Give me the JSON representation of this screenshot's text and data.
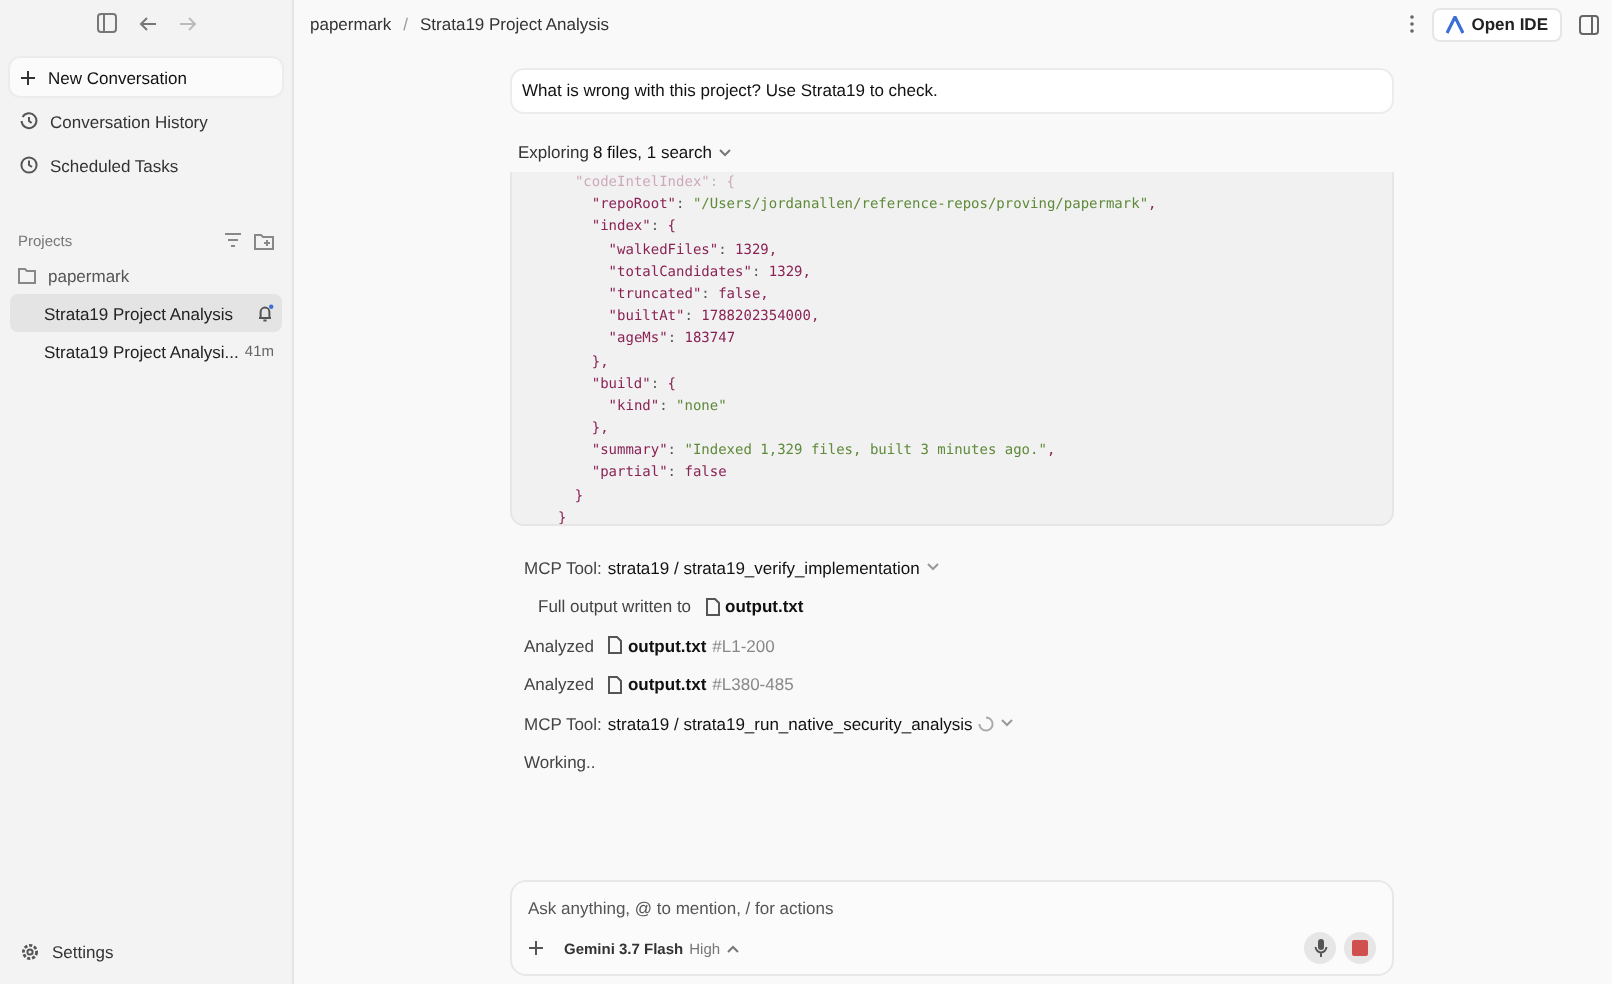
{
  "sidebar": {
    "nav": [
      {
        "kind": "new",
        "label": "New Conversation"
      },
      {
        "kind": "history",
        "label": "Conversation History"
      },
      {
        "kind": "scheduled",
        "label": "Scheduled Tasks"
      }
    ],
    "projects_label": "Projects",
    "project": {
      "name": "papermark",
      "conversations": [
        {
          "title": "Strata19 Project Analysis",
          "selected": true
        },
        {
          "title": "Strata19 Project Analysi...",
          "time": "41m",
          "selected": false
        }
      ]
    },
    "settings": "Settings"
  },
  "breadcrumb": [
    "papermark",
    "Strata19 Project Analysis"
  ],
  "breadcrumb_separator": "/",
  "open_ide": "Open IDE",
  "user_message": "What is wrong with this project? Use Strata19 to check.",
  "exploring": {
    "prefix": "Exploring",
    "summary": "8 files, 1 search"
  },
  "code_lines": [
    {
      "text": "  \"codeIntelIndex\": {",
      "faded": true
    },
    {
      "text": "    \"repoRoot\": \"/Users/jordanallen/reference-repos/proving/papermark\",",
      "faded": false
    },
    {
      "text": "    \"index\": {",
      "faded": false
    },
    {
      "text": "      \"walkedFiles\": 1329,",
      "faded": false
    },
    {
      "text": "      \"totalCandidates\": 1329,",
      "faded": false
    },
    {
      "text": "      \"truncated\": false,",
      "faded": false
    },
    {
      "text": "      \"builtAt\": 1788202354000,",
      "faded": false
    },
    {
      "text": "      \"ageMs\": 183747",
      "faded": false
    },
    {
      "text": "    },",
      "faded": false
    },
    {
      "text": "    \"build\": {",
      "faded": false
    },
    {
      "text": "      \"kind\": \"none\"",
      "faded": false
    },
    {
      "text": "    },",
      "faded": false
    },
    {
      "text": "    \"summary\": \"Indexed 1,329 files, built 3 minutes ago.\",",
      "faded": false
    },
    {
      "text": "    \"partial\": false",
      "faded": false
    },
    {
      "text": "  }",
      "faded": false
    },
    {
      "text": "}",
      "faded": false
    }
  ],
  "steps": [
    {
      "kind": "tool",
      "prefix": "MCP Tool:",
      "name": "strata19 / strata19_verify_implementation",
      "running": false
    },
    {
      "kind": "output",
      "text": "Full output written to",
      "file": "output.txt"
    },
    {
      "kind": "analyzed",
      "text": "Analyzed",
      "file": "output.txt",
      "range": "#L1-200"
    },
    {
      "kind": "analyzed",
      "text": "Analyzed",
      "file": "output.txt",
      "range": "#L380-485"
    },
    {
      "kind": "tool",
      "prefix": "MCP Tool:",
      "name": "strata19 / strata19_run_native_security_analysis",
      "running": true
    },
    {
      "kind": "status",
      "text": "Working.."
    }
  ],
  "composer": {
    "placeholder": "Ask anything, @ to mention, / for actions",
    "model": "Gemini 3.7 Flash",
    "effort": "High"
  }
}
